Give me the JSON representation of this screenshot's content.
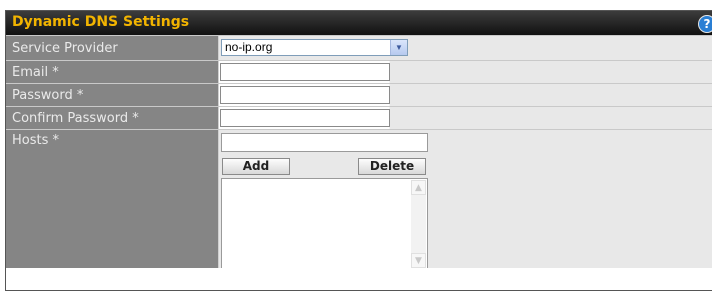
{
  "panel": {
    "title": "Dynamic DNS Settings",
    "help_icon_glyph": "?",
    "colors": {
      "title": "#f2b400",
      "label_bg": "#858585",
      "field_bg": "#e8e8e8"
    }
  },
  "form": {
    "service_provider": {
      "label": "Service Provider",
      "value": "no-ip.org"
    },
    "email": {
      "label": "Email *",
      "value": ""
    },
    "password": {
      "label": "Password *",
      "value": ""
    },
    "confirm_password": {
      "label": "Confirm Password *",
      "value": ""
    },
    "hosts": {
      "label": "Hosts *",
      "input_value": "",
      "add_label": "Add",
      "delete_label": "Delete",
      "list_items": []
    }
  },
  "icons": {
    "help": "help-icon",
    "dropdown": "chevron-down-icon",
    "scroll_up": "scroll-up-icon",
    "scroll_down": "scroll-down-icon"
  }
}
